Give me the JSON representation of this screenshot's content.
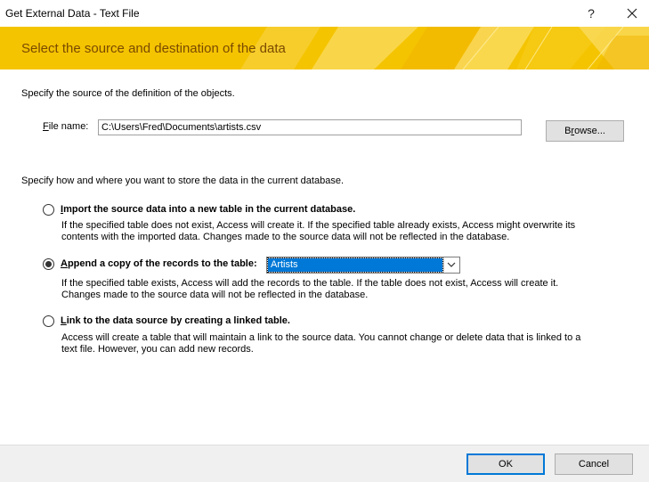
{
  "window": {
    "title": "Get External Data - Text File",
    "help": "?",
    "close": "✕"
  },
  "banner": {
    "title": "Select the source and destination of the data",
    "color": "#f5c400",
    "text_color": "#7a4a00"
  },
  "source": {
    "instruction": "Specify the source of the definition of the objects.",
    "file_label_accel": "F",
    "file_label_rest": "ile name:",
    "file_value": "C:\\Users\\Fred\\Documents\\artists.csv",
    "browse_accel": "r",
    "browse_pre": "B",
    "browse_post": "owse..."
  },
  "destination": {
    "instruction": "Specify how and where you want to store the data in the current database.",
    "options": [
      {
        "accel": "I",
        "label_rest": "mport the source data into a new table in the current database.",
        "checked": false,
        "desc1": "If the specified table does not exist, Access will create it. If the specified table already exists, Access might overwrite its",
        "desc2": "contents with the imported data. Changes made to the source data will not be reflected in the database."
      },
      {
        "accel": "A",
        "label_rest": "ppend a copy of the records to the table:",
        "checked": true,
        "table_value": "Artists",
        "desc1": "If the specified table exists, Access will add the records to the table. If the table does not exist, Access will create it.",
        "desc2": "Changes made to the source data will not be reflected in the database."
      },
      {
        "accel": "L",
        "label_rest": "ink to the data source by creating a linked table.",
        "checked": false,
        "desc1": "Access will create a table that will maintain a link to the source data. You cannot change or delete data that is linked to a",
        "desc2": "text file. However, you can add new records."
      }
    ]
  },
  "footer": {
    "ok": "OK",
    "cancel": "Cancel"
  }
}
